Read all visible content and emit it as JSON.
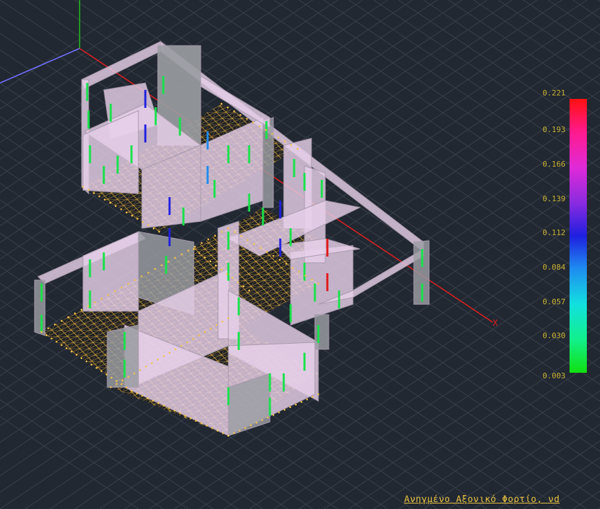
{
  "legend": {
    "values": [
      "0.221",
      "0.193",
      "0.166",
      "0.139",
      "0.112",
      "0.084",
      "0.057",
      "0.030",
      "0.003"
    ]
  },
  "axis": {
    "x_label": "X"
  },
  "caption": "Ανηγμένο Αξονικό Φορτίο, νd",
  "colors": {
    "background": "#222831",
    "grid": "#39404b",
    "structure": "#e7cfe9",
    "mesh": "#f0b640",
    "legend_text": "#c9b233",
    "caption": "#e8c341",
    "x_axis": "#e02020",
    "y_axis": "#20c020",
    "z_axis": "#7070ff"
  }
}
